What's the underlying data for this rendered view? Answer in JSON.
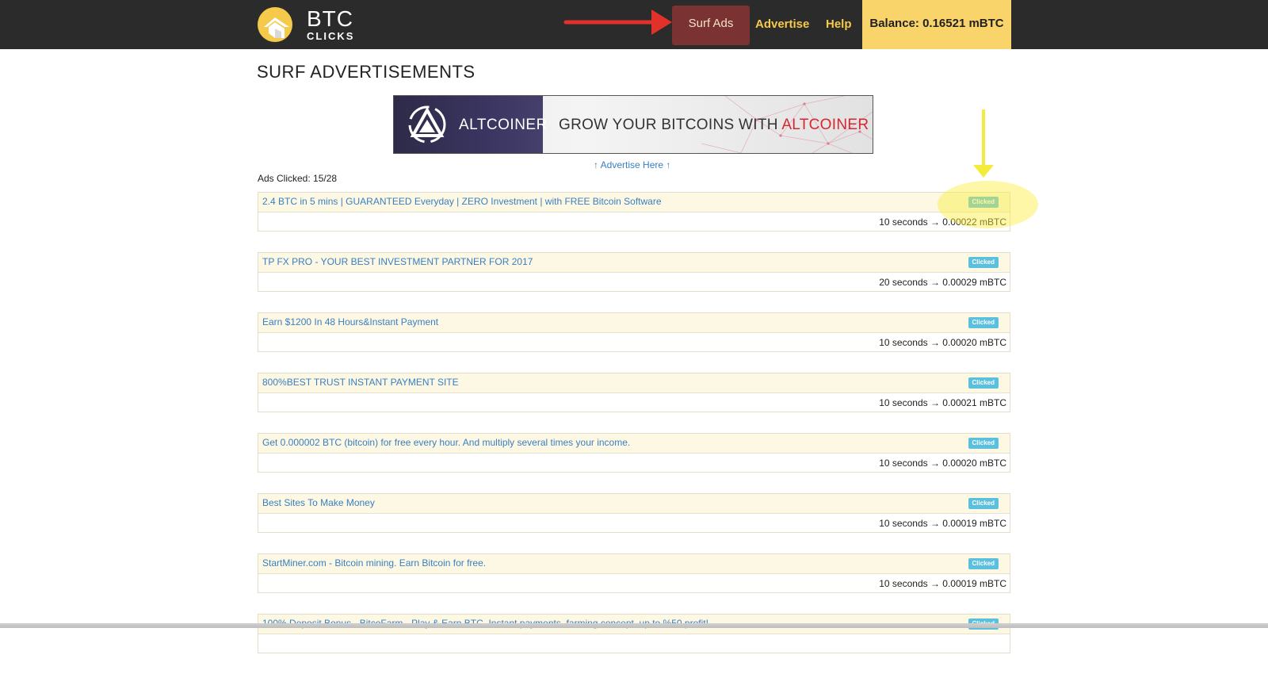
{
  "header": {
    "logo_big": "BTC",
    "logo_small": "CLICKS",
    "nav": {
      "surf_ads": "Surf Ads",
      "advertise": "Advertise",
      "help": "Help"
    },
    "balance": "Balance: 0.16521 mBTC"
  },
  "page": {
    "title": "SURF ADVERTISEMENTS",
    "banner": {
      "brand": "ALTCOINER",
      "tagline_prefix": "GROW YOUR BITCOINS WITH ",
      "tagline_highlight": "ALTCOINER"
    },
    "advertise_here": "↑ Advertise Here ↑",
    "ads_clicked": "Ads Clicked: 15/28"
  },
  "ads": [
    {
      "title": "2.4 BTC in 5 mins | GUARANTEED Everyday | ZERO Investment | with FREE Bitcoin Software",
      "status": "Clicked",
      "reward": "10 seconds → 0.00022 mBTC"
    },
    {
      "title": "TP FX PRO - YOUR BEST INVESTMENT PARTNER FOR 2017",
      "status": "Clicked",
      "reward": "20 seconds → 0.00029 mBTC"
    },
    {
      "title": "Earn $1200 In 48 Hours&Instant Payment",
      "status": "Clicked",
      "reward": "10 seconds → 0.00020 mBTC"
    },
    {
      "title": "800%BEST TRUST INSTANT PAYMENT SITE",
      "status": "Clicked",
      "reward": "10 seconds → 0.00021 mBTC"
    },
    {
      "title": "Get 0.000002 BTC (bitcoin) for free every hour. And multiply several times your income.",
      "status": "Clicked",
      "reward": "10 seconds → 0.00020 mBTC"
    },
    {
      "title": "Best Sites To Make Money",
      "status": "Clicked",
      "reward": "10 seconds → 0.00019 mBTC"
    },
    {
      "title": "StartMiner.com - Bitcoin mining. Earn Bitcoin for free.",
      "status": "Clicked",
      "reward": "10 seconds → 0.00019 mBTC"
    },
    {
      "title": "100% Deposit Bonus - BitcoFarm - Play & Earn BTC, Instant payments, farming concept, up to %50 profit!",
      "status": "Clicked",
      "reward": ""
    }
  ],
  "colors": {
    "header_bg": "#2b2b2b",
    "nav_text": "#f5c94a",
    "active_nav_bg": "#7a3232",
    "balance_bg": "#f9d46b",
    "link": "#3a7fc1",
    "ad_head_bg": "#fcf8e3",
    "badge": "#5bc0de",
    "annotation_red": "#e0312b",
    "annotation_yellow": "#f4ec3c"
  },
  "icons": {
    "logo": "btc-clicks-logo-icon",
    "banner_logo": "altcoiner-logo-icon",
    "arrow_red": "red-annotation-arrow-icon",
    "arrow_yellow": "yellow-annotation-arrow-icon"
  }
}
